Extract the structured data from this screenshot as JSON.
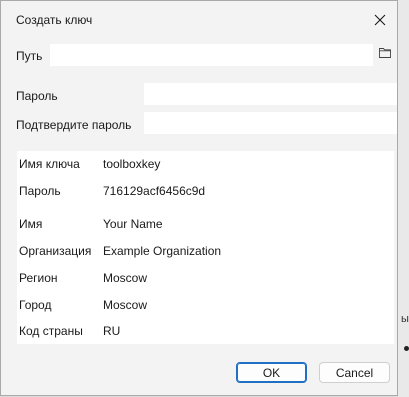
{
  "dialog": {
    "title": "Создать ключ",
    "close_icon": "close-icon"
  },
  "form": {
    "path_label": "Путь",
    "path_value": "",
    "folder_icon": "folder-icon",
    "password_label": "Пароль",
    "password_value": "",
    "confirm_label": "Подтвердите пароль",
    "confirm_value": ""
  },
  "info": {
    "rows": [
      {
        "key": "Имя ключа",
        "value": "toolboxkey"
      },
      {
        "key": "Пароль",
        "value": "716129acf6456c9d"
      },
      {
        "key": "Имя",
        "value": "Your Name"
      },
      {
        "key": "Организация",
        "value": "Example Organization"
      },
      {
        "key": "Регион",
        "value": "Moscow"
      },
      {
        "key": "Город",
        "value": "Moscow"
      },
      {
        "key": "Код страны",
        "value": "RU"
      }
    ]
  },
  "buttons": {
    "ok": "OK",
    "cancel": "Cancel"
  },
  "background": {
    "partial_text": "ы"
  },
  "colors": {
    "accent": "#1f6fc5",
    "dialog_bg": "#f3f3f3"
  }
}
